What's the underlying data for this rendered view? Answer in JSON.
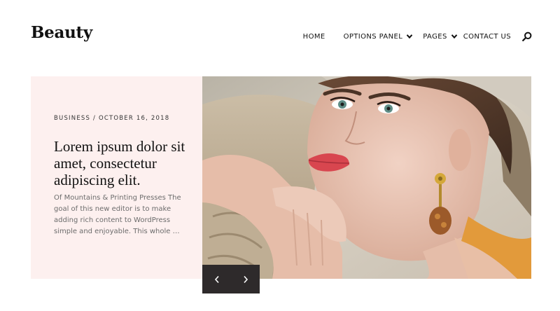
{
  "header": {
    "logo": "Beauty",
    "nav": [
      {
        "label": "HOME"
      },
      {
        "label": "OPTIONS PANEL",
        "icon": "chevron-down-icon"
      },
      {
        "label": "PAGES",
        "icon": "chevron-down-icon"
      },
      {
        "label": "CONTACT US"
      }
    ],
    "search_icon": "search-icon"
  },
  "slide": {
    "category": "BUSINESS",
    "separator": "/",
    "date": "OCTOBER 16, 2018",
    "title": "Lorem ipsum dolor sit amet, consectetur adipiscing elit.",
    "excerpt": "Of Mountains & Printing Presses The goal of this new editor is to make adding rich content to WordPress simple and enjoyable. This whole …",
    "image": "portrait-photo"
  },
  "slider_controls": {
    "prev_icon": "chevron-left-icon",
    "next_icon": "chevron-right-icon"
  },
  "colors": {
    "card_background": "#fdf0ef",
    "controls_background": "#2e2a2b"
  }
}
